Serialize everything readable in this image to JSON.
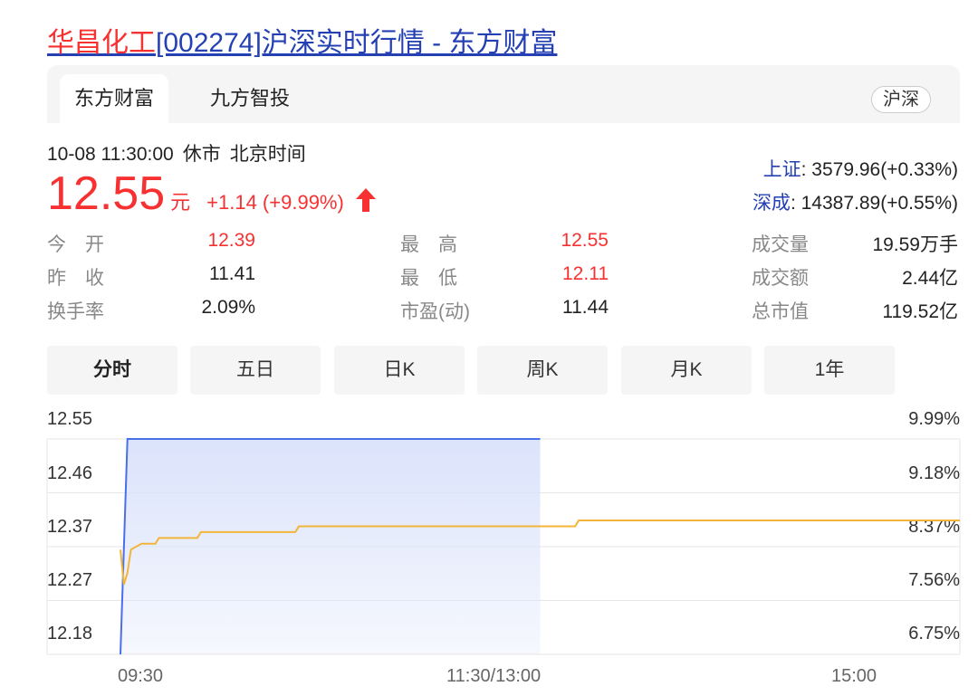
{
  "page": {
    "title_highlight": "华昌化工",
    "title_rest": "[002274]沪深实时行情 - 东方财富"
  },
  "tabs": [
    {
      "label": "东方财富",
      "active": true
    },
    {
      "label": "九方智投",
      "active": false
    }
  ],
  "market_badge": "沪深",
  "status": {
    "datetime": "10-08 11:30:00",
    "state": "休市",
    "timezone": "北京时间"
  },
  "quote": {
    "price": "12.55",
    "unit": "元",
    "change": "+1.14 (+9.99%)"
  },
  "indices": [
    {
      "name": "上证",
      "value": ": 3579.96(+0.33%)"
    },
    {
      "name": "深成",
      "value": ": 14387.89(+0.55%)"
    }
  ],
  "stats": {
    "open_label": "今　开",
    "open_value": "12.39",
    "prev_close_label": "昨　收",
    "prev_close_value": "11.41",
    "turnover_rate_label": "换手率",
    "turnover_rate_value": "2.09%",
    "high_label": "最　高",
    "high_value": "12.55",
    "low_label": "最　低",
    "low_value": "12.11",
    "pe_label": "市盈(动)",
    "pe_value": "11.44",
    "volume_label": "成交量",
    "volume_value": "19.59万手",
    "amount_label": "成交额",
    "amount_value": "2.44亿",
    "market_cap_label": "总市值",
    "market_cap_value": "119.52亿"
  },
  "period_tabs": [
    "分时",
    "五日",
    "日K",
    "周K",
    "月K",
    "1年"
  ],
  "colors": {
    "up": "#f73131",
    "link": "#2440b3",
    "price_line": "#4a6fe8",
    "avg_line": "#f2b53a",
    "fill": "#dbe3fb"
  },
  "chart_data": {
    "type": "line",
    "title": "",
    "x_ticks": [
      "09:30",
      "11:30/13:00",
      "15:00"
    ],
    "y_ticks_left": [
      "12.55",
      "12.46",
      "12.37",
      "12.27",
      "12.18"
    ],
    "y_ticks_right": [
      "9.99%",
      "9.18%",
      "8.37%",
      "7.56%",
      "6.75%"
    ],
    "ylim": [
      12.18,
      12.55
    ],
    "x_session_minutes": 240,
    "grid": true,
    "series": [
      {
        "role": "price",
        "points": [
          [
            0,
            12.18
          ],
          [
            2,
            12.55
          ],
          [
            120,
            12.55
          ]
        ]
      },
      {
        "role": "average",
        "points": [
          [
            0,
            12.36
          ],
          [
            1,
            12.3
          ],
          [
            2,
            12.32
          ],
          [
            3,
            12.36
          ],
          [
            6,
            12.37
          ],
          [
            10,
            12.37
          ],
          [
            11,
            12.38
          ],
          [
            22,
            12.38
          ],
          [
            23,
            12.39
          ],
          [
            50,
            12.39
          ],
          [
            51,
            12.4
          ],
          [
            130,
            12.4
          ],
          [
            131,
            12.41
          ],
          [
            240,
            12.41
          ]
        ]
      }
    ]
  }
}
